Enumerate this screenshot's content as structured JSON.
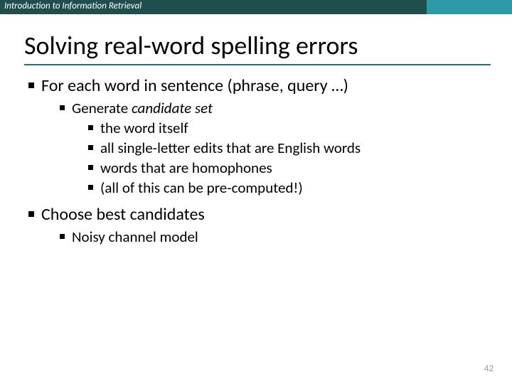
{
  "header": "Introduction to Information Retrieval",
  "title": "Solving real-word spelling errors",
  "b1": "For each word in sentence (phrase, query …)",
  "b1_1a": "Generate ",
  "b1_1b": "candidate set",
  "b1_1_1": "the word itself",
  "b1_1_2": "all single-letter edits that are English words",
  "b1_1_3": "words that are homophones",
  "b1_1_4": "(all of this can be pre-computed!)",
  "b2": "Choose best candidates",
  "b2_1": "Noisy channel model",
  "slide_number": "42"
}
